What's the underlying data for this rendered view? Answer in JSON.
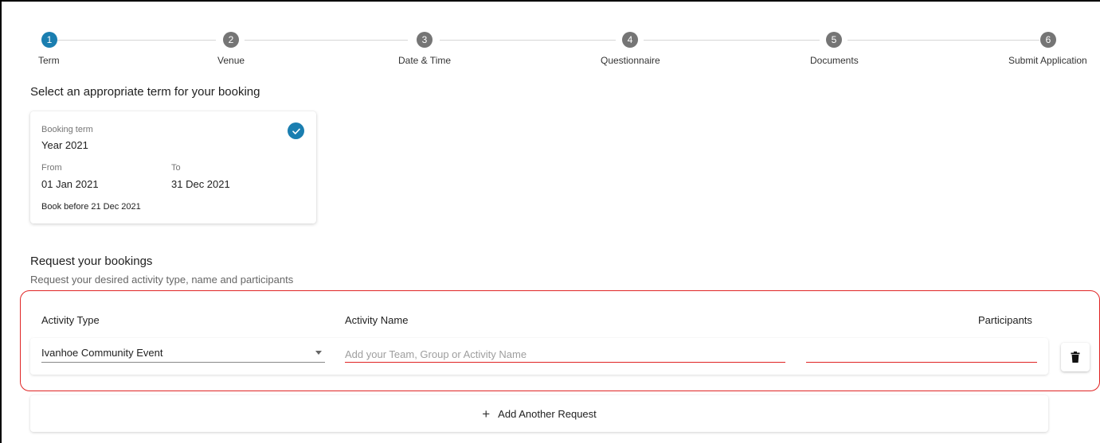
{
  "stepper": {
    "steps": [
      {
        "number": "1",
        "label": "Term",
        "active": true
      },
      {
        "number": "2",
        "label": "Venue",
        "active": false
      },
      {
        "number": "3",
        "label": "Date & Time",
        "active": false
      },
      {
        "number": "4",
        "label": "Questionnaire",
        "active": false
      },
      {
        "number": "5",
        "label": "Documents",
        "active": false
      },
      {
        "number": "6",
        "label": "Submit Application",
        "active": false
      }
    ]
  },
  "term_section": {
    "title": "Select an appropriate term for your booking",
    "card": {
      "booking_term_label": "Booking term",
      "booking_term_value": "Year 2021",
      "from_label": "From",
      "from_value": "01 Jan 2021",
      "to_label": "To",
      "to_value": "31 Dec 2021",
      "deadline": "Book before 21 Dec 2021"
    }
  },
  "request_section": {
    "title": "Request your bookings",
    "subtitle": "Request your desired activity type, name and participants",
    "columns": {
      "activity_type": "Activity Type",
      "activity_name": "Activity Name",
      "participants": "Participants"
    },
    "row": {
      "activity_type_value": "Ivanhoe Community Event",
      "activity_name_value": "",
      "activity_name_placeholder": "Add your Team, Group or Activity Name",
      "participants_value": ""
    },
    "add_button_label": "Add Another Request"
  },
  "colors": {
    "accent": "#1a7eb0",
    "error": "#e02424",
    "inactive_step": "#757575"
  }
}
